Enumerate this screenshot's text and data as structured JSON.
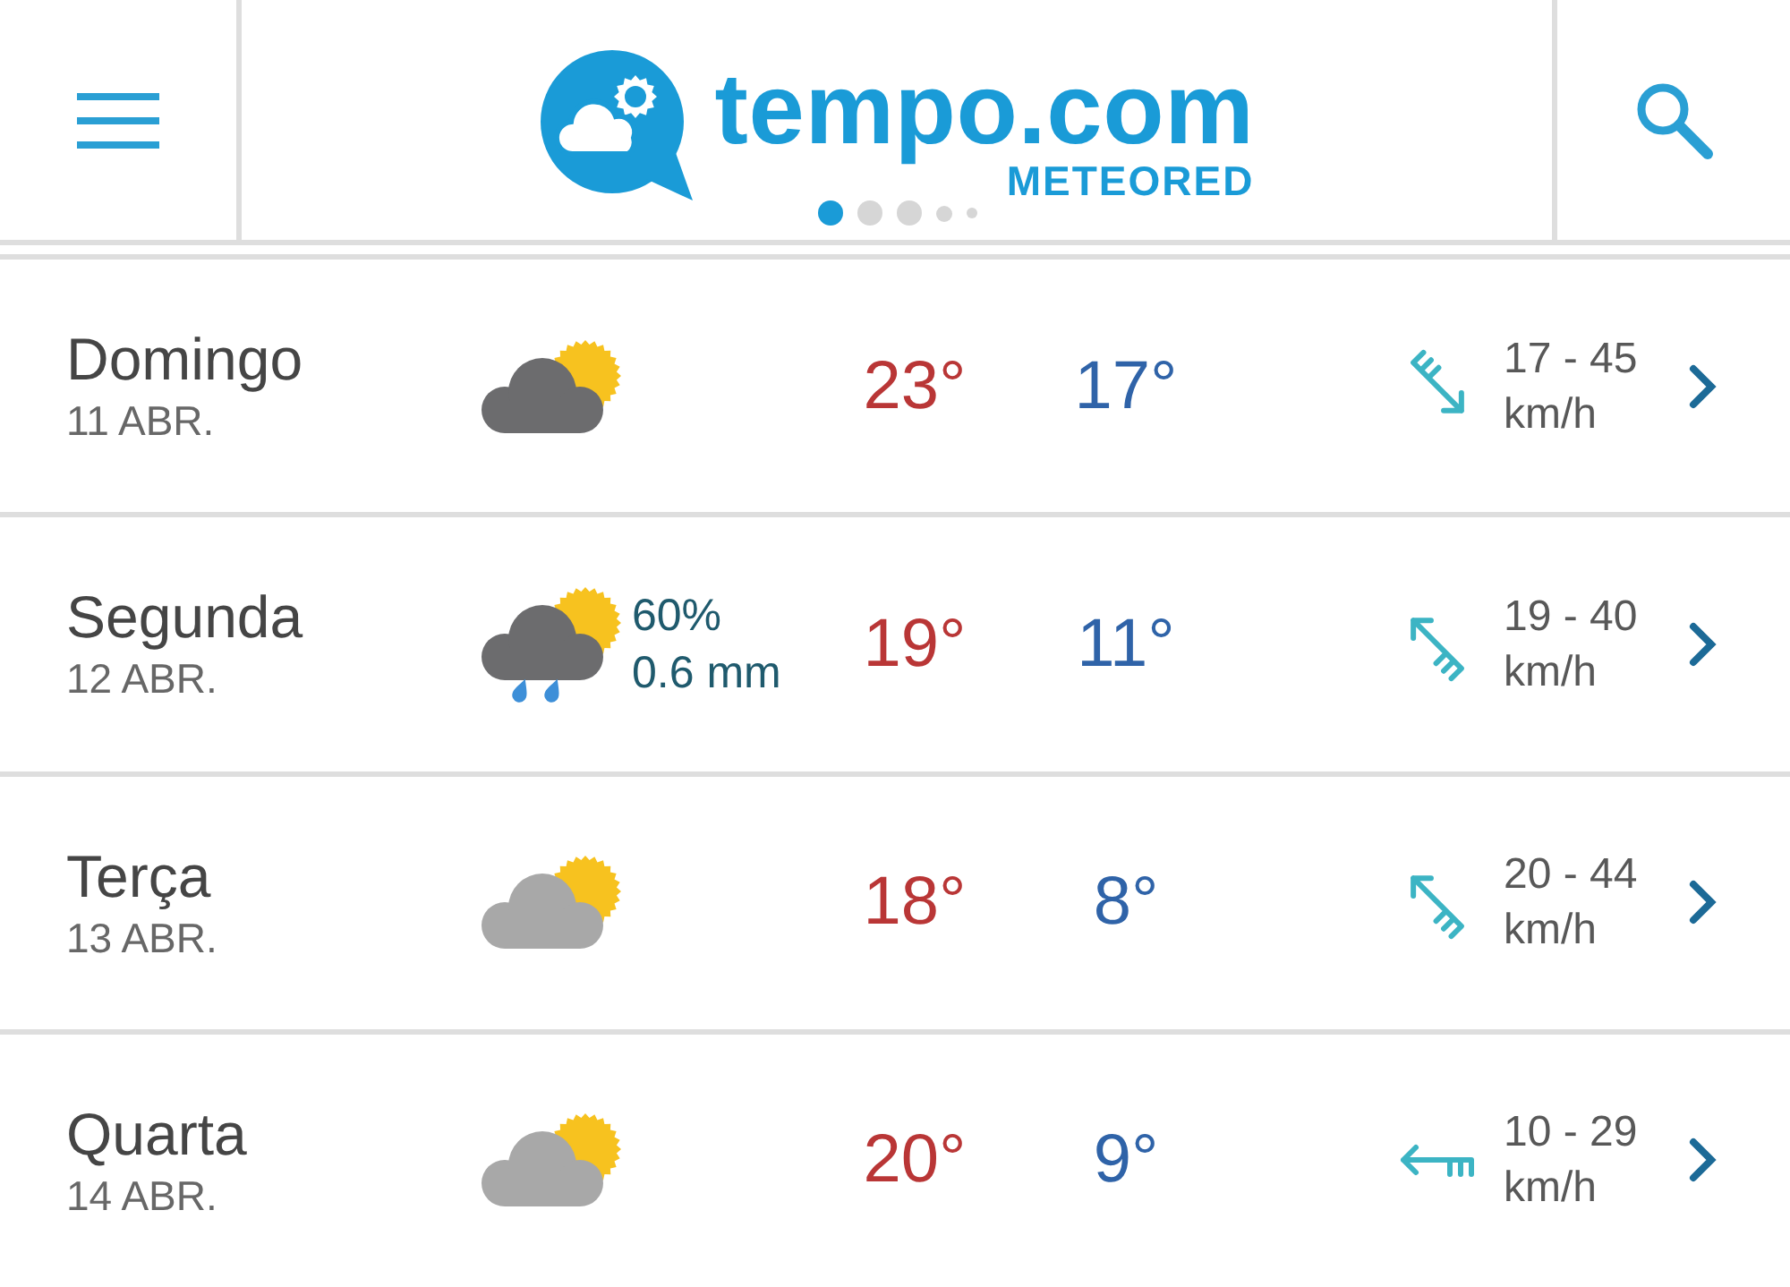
{
  "header": {
    "logo": {
      "wordmark": "tempo.com",
      "tagline": "METEORED"
    },
    "carousel_dots": [
      {
        "selected": true
      },
      {
        "selected": false
      },
      {
        "selected": false
      },
      {
        "selected": false
      },
      {
        "selected": false
      }
    ]
  },
  "days": [
    {
      "name": "Domingo",
      "date": "11 ABR.",
      "weather_icon": {
        "kind": "cloudy"
      },
      "max": "23°",
      "min": "17°",
      "wind_arrow": {
        "kind": "southeast"
      },
      "wind": "17 - 45",
      "wind_unit": "km/h"
    },
    {
      "name": "Segunda",
      "date": "12 ABR.",
      "weather_icon": {
        "kind": "showers"
      },
      "precip": {
        "chance": "60%",
        "amount": "0.6 mm"
      },
      "max": "19°",
      "min": "11°",
      "wind_arrow": {
        "kind": "northwest"
      },
      "wind": "19 - 40",
      "wind_unit": "km/h"
    },
    {
      "name": "Terça",
      "date": "13 ABR.",
      "weather_icon": {
        "kind": "partlycloudy"
      },
      "max": "18°",
      "min": "8°",
      "wind_arrow": {
        "kind": "northwest"
      },
      "wind": "20 - 44",
      "wind_unit": "km/h"
    },
    {
      "name": "Quarta",
      "date": "14 ABR.",
      "weather_icon": {
        "kind": "partlycloudy"
      },
      "max": "20°",
      "min": "9°",
      "wind_arrow": {
        "kind": "west"
      },
      "wind": "10 - 29",
      "wind_unit": "km/h"
    }
  ]
}
